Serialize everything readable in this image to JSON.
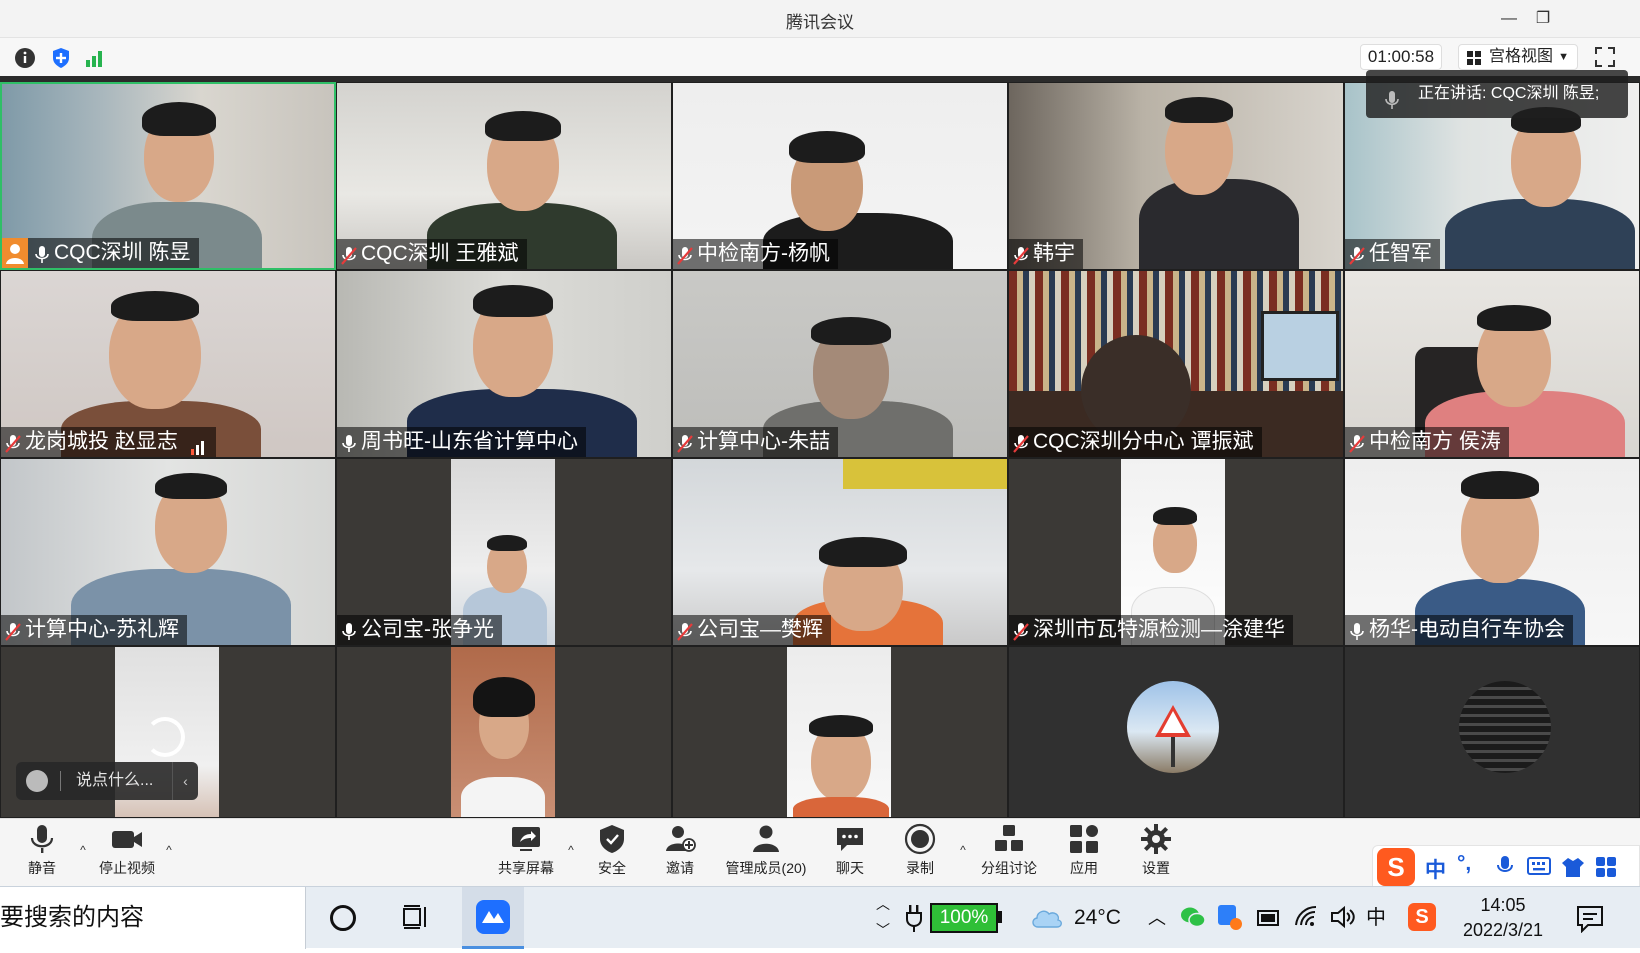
{
  "window": {
    "title": "腾讯会议",
    "minimize": "—",
    "restore": "❐"
  },
  "toolbar": {
    "timer": "01:00:58",
    "view_mode": "宫格视图",
    "view_caret": "▼"
  },
  "speaking": {
    "label": "正在讲话: CQC深圳 陈昱;"
  },
  "participants": [
    {
      "name": "CQC深圳 陈昱"
    },
    {
      "name": "CQC深圳 王雅斌"
    },
    {
      "name": "中检南方-杨帆"
    },
    {
      "name": "韩宇"
    },
    {
      "name": "任智军"
    },
    {
      "name": "龙岗城投 赵显志"
    },
    {
      "name": "周书旺-山东省计算中心"
    },
    {
      "name": "计算中心-朱喆"
    },
    {
      "name": "CQC深圳分中心 谭振斌"
    },
    {
      "name": "中检南方 侯涛"
    },
    {
      "name": "计算中心-苏礼辉"
    },
    {
      "name": "公司宝-张争光"
    },
    {
      "name": "公司宝—樊辉"
    },
    {
      "name": "深圳市瓦特源检测—涂建华"
    },
    {
      "name": "杨华-电动自行车协会"
    }
  ],
  "chat_input": {
    "placeholder": "说点什么...",
    "collapse": "‹"
  },
  "controls": {
    "mute": "静音",
    "stop_video": "停止视频",
    "share": "共享屏幕",
    "security": "安全",
    "invite": "邀请",
    "members": "管理成员(20)",
    "chat": "聊天",
    "record": "录制",
    "breakout": "分组讨论",
    "apps": "应用",
    "settings": "设置",
    "chevron": "^"
  },
  "taskbar": {
    "search_text": "要搜索的内容",
    "battery": "100%",
    "weather_temp": "24°C",
    "ime_lang": "中",
    "time": "14:05",
    "date": "2022/3/21"
  },
  "ime_bar": {
    "lang": "中",
    "punct": "°,"
  },
  "colors": {
    "accent_green": "#2fbf67",
    "host_orange": "#f08c2e",
    "tencent_blue": "#1e6fff"
  }
}
